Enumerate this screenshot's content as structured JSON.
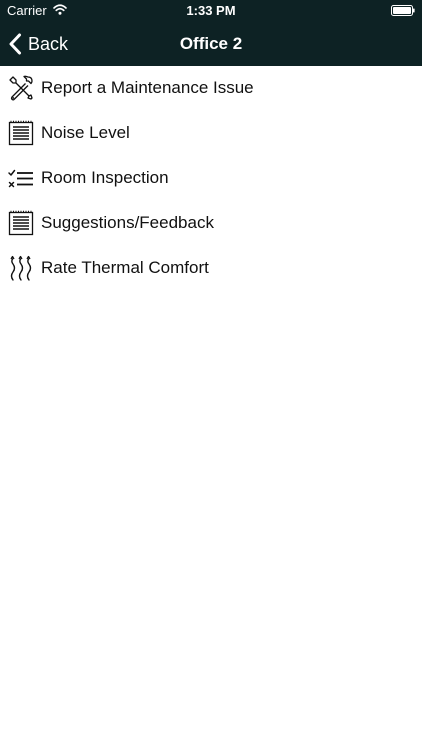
{
  "status_bar": {
    "carrier": "Carrier",
    "time": "1:33 PM",
    "icons": [
      "wifi-icon",
      "battery-icon"
    ]
  },
  "nav": {
    "back_label": "Back",
    "title": "Office 2"
  },
  "menu": {
    "items": [
      {
        "label": "Report a Maintenance Issue",
        "icon": "tools-icon"
      },
      {
        "label": "Noise Level",
        "icon": "notepad-icon"
      },
      {
        "label": "Room Inspection",
        "icon": "checklist-icon"
      },
      {
        "label": "Suggestions/Feedback",
        "icon": "notepad-icon"
      },
      {
        "label": "Rate Thermal Comfort",
        "icon": "heat-waves-icon"
      }
    ]
  },
  "colors": {
    "header_background": "#0d2224",
    "header_text": "#ffffff",
    "body_background": "#ffffff",
    "item_text": "#111111"
  }
}
